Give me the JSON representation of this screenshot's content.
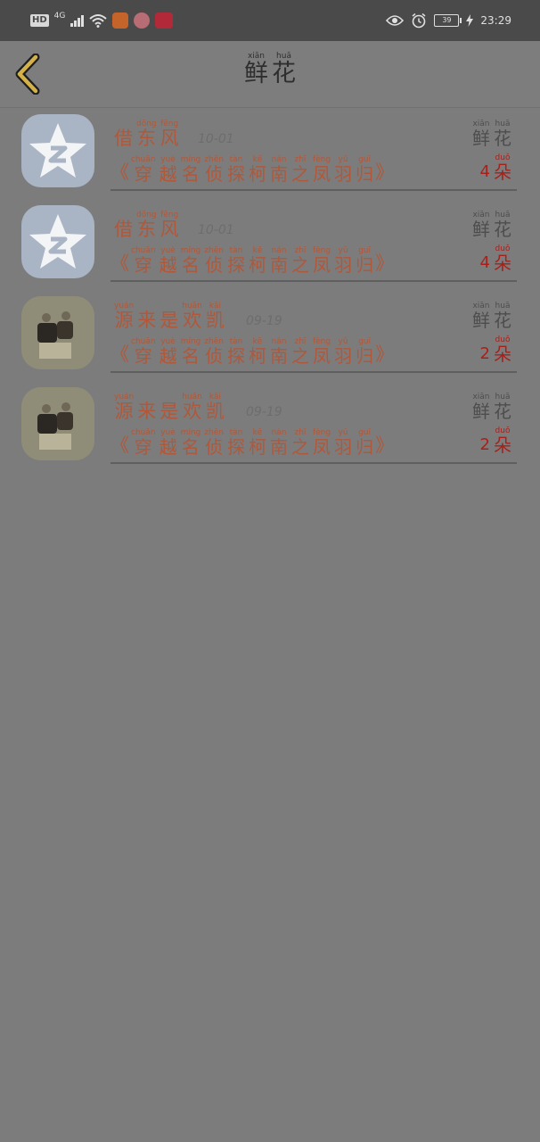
{
  "status_bar": {
    "hd": "HD",
    "network": "4G",
    "battery": "39",
    "time": "23:29",
    "icons": [
      "hd-icon",
      "signal-icon",
      "wifi-icon",
      "video-app-icon",
      "avatar-app-icon",
      "news-app-icon",
      "eye-icon",
      "alarm-icon",
      "battery-icon",
      "charging-icon"
    ]
  },
  "header": {
    "back_icon": "chevron-left-icon",
    "title": [
      {
        "py": "xiān",
        "hz": "鲜"
      },
      {
        "py": "huā",
        "hz": "花"
      }
    ]
  },
  "gift_list": [
    {
      "avatar": "qq-default-avatar",
      "sender": [
        {
          "py": "",
          "hz": "借"
        },
        {
          "py": "dōng",
          "hz": "东"
        },
        {
          "py": "fēng",
          "hz": "风"
        }
      ],
      "date": "10-01",
      "gift": [
        {
          "py": "xiān",
          "hz": "鲜"
        },
        {
          "py": "huā",
          "hz": "花"
        }
      ],
      "program": [
        {
          "py": "chuān",
          "hz": "穿"
        },
        {
          "py": "yuè",
          "hz": "越"
        },
        {
          "py": "míng",
          "hz": "名"
        },
        {
          "py": "zhēn",
          "hz": "侦"
        },
        {
          "py": "tàn",
          "hz": "探"
        },
        {
          "py": "kē",
          "hz": "柯"
        },
        {
          "py": "nán",
          "hz": "南"
        },
        {
          "py": "zhī",
          "hz": "之"
        },
        {
          "py": "fèng",
          "hz": "凤"
        },
        {
          "py": "yǔ",
          "hz": "羽"
        },
        {
          "py": "guī",
          "hz": "归"
        }
      ],
      "count": "4",
      "unit": {
        "py": "duǒ",
        "hz": "朵"
      }
    },
    {
      "avatar": "qq-default-avatar",
      "sender": [
        {
          "py": "",
          "hz": "借"
        },
        {
          "py": "dōng",
          "hz": "东"
        },
        {
          "py": "fēng",
          "hz": "风"
        }
      ],
      "date": "10-01",
      "gift": [
        {
          "py": "xiān",
          "hz": "鲜"
        },
        {
          "py": "huā",
          "hz": "花"
        }
      ],
      "program": [
        {
          "py": "chuān",
          "hz": "穿"
        },
        {
          "py": "yuè",
          "hz": "越"
        },
        {
          "py": "míng",
          "hz": "名"
        },
        {
          "py": "zhēn",
          "hz": "侦"
        },
        {
          "py": "tàn",
          "hz": "探"
        },
        {
          "py": "kē",
          "hz": "柯"
        },
        {
          "py": "nán",
          "hz": "南"
        },
        {
          "py": "zhī",
          "hz": "之"
        },
        {
          "py": "fèng",
          "hz": "凤"
        },
        {
          "py": "yǔ",
          "hz": "羽"
        },
        {
          "py": "guī",
          "hz": "归"
        }
      ],
      "count": "4",
      "unit": {
        "py": "duǒ",
        "hz": "朵"
      }
    },
    {
      "avatar": "photo-avatar",
      "sender": [
        {
          "py": "yuán",
          "hz": "源"
        },
        {
          "py": "",
          "hz": "来"
        },
        {
          "py": "",
          "hz": "是"
        },
        {
          "py": "huān",
          "hz": "欢"
        },
        {
          "py": "kǎi",
          "hz": "凯"
        }
      ],
      "date": "09-19",
      "gift": [
        {
          "py": "xiān",
          "hz": "鲜"
        },
        {
          "py": "huā",
          "hz": "花"
        }
      ],
      "program": [
        {
          "py": "chuān",
          "hz": "穿"
        },
        {
          "py": "yuè",
          "hz": "越"
        },
        {
          "py": "míng",
          "hz": "名"
        },
        {
          "py": "zhēn",
          "hz": "侦"
        },
        {
          "py": "tàn",
          "hz": "探"
        },
        {
          "py": "kē",
          "hz": "柯"
        },
        {
          "py": "nán",
          "hz": "南"
        },
        {
          "py": "zhī",
          "hz": "之"
        },
        {
          "py": "fèng",
          "hz": "凤"
        },
        {
          "py": "yǔ",
          "hz": "羽"
        },
        {
          "py": "guī",
          "hz": "归"
        }
      ],
      "count": "2",
      "unit": {
        "py": "duǒ",
        "hz": "朵"
      }
    },
    {
      "avatar": "photo-avatar",
      "sender": [
        {
          "py": "yuán",
          "hz": "源"
        },
        {
          "py": "",
          "hz": "来"
        },
        {
          "py": "",
          "hz": "是"
        },
        {
          "py": "huān",
          "hz": "欢"
        },
        {
          "py": "kǎi",
          "hz": "凯"
        }
      ],
      "date": "09-19",
      "gift": [
        {
          "py": "xiān",
          "hz": "鲜"
        },
        {
          "py": "huā",
          "hz": "花"
        }
      ],
      "program": [
        {
          "py": "chuān",
          "hz": "穿"
        },
        {
          "py": "yuè",
          "hz": "越"
        },
        {
          "py": "míng",
          "hz": "名"
        },
        {
          "py": "zhēn",
          "hz": "侦"
        },
        {
          "py": "tàn",
          "hz": "探"
        },
        {
          "py": "kē",
          "hz": "柯"
        },
        {
          "py": "nán",
          "hz": "南"
        },
        {
          "py": "zhī",
          "hz": "之"
        },
        {
          "py": "fèng",
          "hz": "凤"
        },
        {
          "py": "yǔ",
          "hz": "羽"
        },
        {
          "py": "guī",
          "hz": "归"
        }
      ],
      "count": "2",
      "unit": {
        "py": "duǒ",
        "hz": "朵"
      }
    }
  ],
  "colors": {
    "overlay": "#7c7c7c",
    "status_bar": "#4a4a4a",
    "accent_orange": "#b0583a",
    "count_red": "#a8201a",
    "back_icon": "#d4b24a"
  }
}
